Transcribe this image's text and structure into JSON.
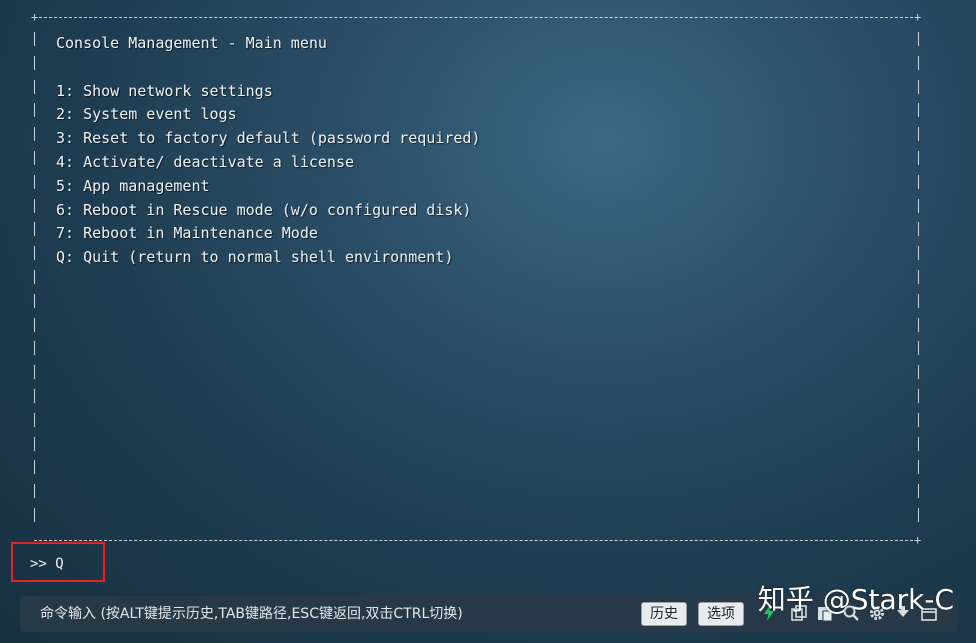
{
  "terminal": {
    "menu_title": "Console Management - Main menu",
    "menu_items": [
      "1: Show network settings",
      "2: System event logs",
      "3: Reset to factory default (password required)",
      "4: Activate/ deactivate a license",
      "5: App management",
      "6: Reboot in Rescue mode (w/o configured disk)",
      "7: Reboot in Maintenance Mode",
      "Q: Quit (return to normal shell environment)"
    ],
    "prompt_symbol": ">>",
    "prompt_input": "Q"
  },
  "command_bar": {
    "hint": "命令输入 (按ALT键提示历史,TAB键路径,ESC键返回,双击CTRL切换)",
    "history_button": "历史",
    "options_button": "选项",
    "icons": [
      "lightning-icon",
      "copy-icon",
      "paste-icon",
      "search-icon",
      "gear-icon",
      "download-icon",
      "window-icon"
    ]
  },
  "watermark": {
    "text": "知乎 @Stark-C"
  },
  "colors": {
    "highlight_border": "#e0242a",
    "background": "#2c5069",
    "accent_lightning": "#22c55e"
  }
}
